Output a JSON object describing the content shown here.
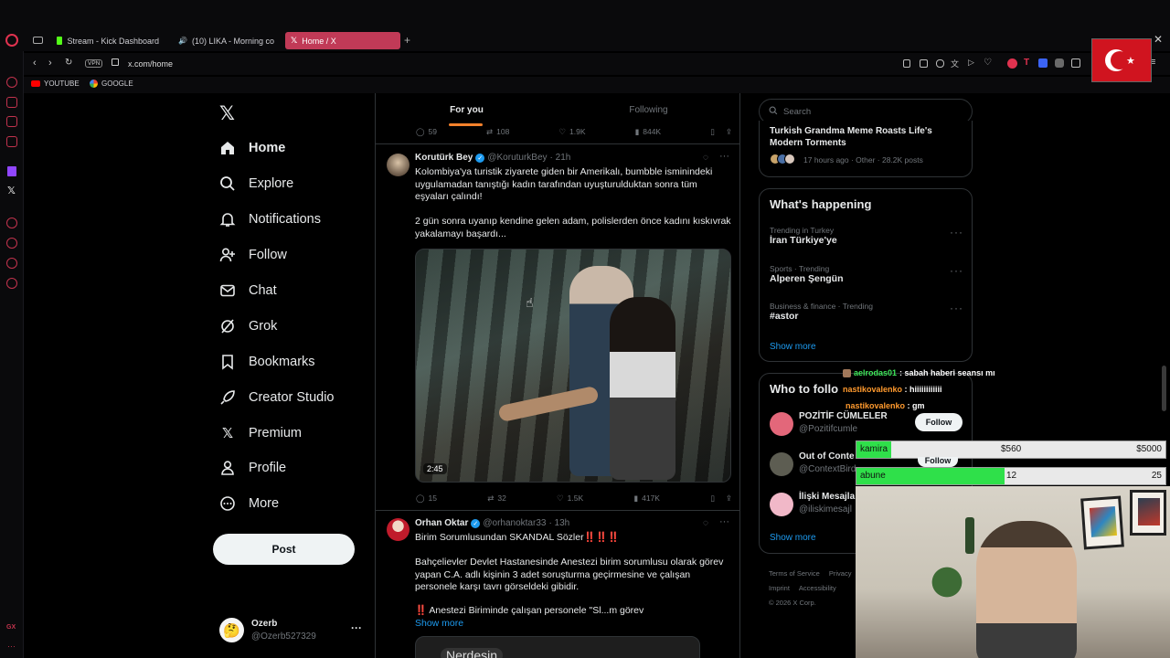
{
  "browser": {
    "tabs": [
      {
        "label": "Stream - Kick Dashboard",
        "icon": "kick-icon"
      },
      {
        "label": "(10) LIKA - Morning co",
        "icon": "youtube-icon"
      },
      {
        "label": "Home / X",
        "icon": "x-icon"
      }
    ],
    "vpn_label": "VPN",
    "url": "x.com/home",
    "bookmarks": [
      {
        "label": "YOUTUBE",
        "icon": "youtube-icon"
      },
      {
        "label": "GOOGLE",
        "icon": "google-icon"
      }
    ]
  },
  "sidebar": {
    "items": [
      {
        "label": "Home",
        "icon": "home-icon"
      },
      {
        "label": "Explore",
        "icon": "search-icon"
      },
      {
        "label": "Notifications",
        "icon": "bell-icon"
      },
      {
        "label": "Follow",
        "icon": "add-person-icon"
      },
      {
        "label": "Chat",
        "icon": "mail-icon"
      },
      {
        "label": "Grok",
        "icon": "grok-icon"
      },
      {
        "label": "Bookmarks",
        "icon": "bookmark-icon"
      },
      {
        "label": "Creator Studio",
        "icon": "rocket-icon"
      },
      {
        "label": "Premium",
        "icon": "x-icon"
      },
      {
        "label": "Profile",
        "icon": "person-icon"
      },
      {
        "label": "More",
        "icon": "more-circle-icon"
      }
    ],
    "post_button": "Post",
    "account": {
      "name": "Ozerb",
      "handle": "@Ozerb527329"
    }
  },
  "timeline": {
    "tabs": [
      "For you",
      "Following"
    ],
    "prev_metrics": {
      "replies": "59",
      "reposts": "108",
      "likes": "1.9K",
      "views": "844K"
    },
    "tweets": [
      {
        "name": "Korutürk Bey",
        "handle": "@KoruturkBey",
        "time": "· 21h",
        "text1": "Kolombiya'ya turistik ziyarete giden bir Amerikalı, bumbble isminindeki uygulamadan tanıştığı kadın tarafından uyuşturulduktan sonra tüm eşyaları çalındı!",
        "text2": "2 gün sonra uyanıp kendine gelen adam, polislerden önce kadını kıskıvrak yakalamayı başardı...",
        "video_duration": "2:45",
        "metrics": {
          "replies": "15",
          "reposts": "32",
          "likes": "1.5K",
          "views": "417K"
        }
      },
      {
        "name": "Orhan Oktar",
        "handle": "@orhanoktar33",
        "time": "· 13h",
        "text1": "Birim Sorumlusundan SKANDAL Sözler‼️‼️‼️",
        "text2": "Bahçelievler Devlet Hastanesinde Anestezi birim sorumlusu olarak görev yapan  C.A. adlı kişinin 3 adet soruşturma geçirmesine ve çalışan personele karşı tavrı görseldeki gibidir.",
        "text3": "‼️ Anestezi Biriminde çalışan personele \"Sl...m görev",
        "show_more": "Show more",
        "media_caption": "Nerdesin"
      }
    ]
  },
  "right": {
    "search_placeholder": "Search",
    "top_story": {
      "title": "Turkish Grandma Meme Roasts Life's Modern Torments",
      "meta": "17 hours ago · Other · 28.2K posts"
    },
    "happening": {
      "title": "What's happening",
      "trends": [
        {
          "meta": "Trending in Turkey",
          "name": "İran Türkiye'ye"
        },
        {
          "meta": "Sports · Trending",
          "name": "Alperen Şengün"
        },
        {
          "meta": "Business & finance · Trending",
          "name": "#astor"
        }
      ],
      "show_more": "Show more"
    },
    "who_to_follow": {
      "title": "Who to follo",
      "accounts": [
        {
          "name": "POZİTİF CÜMLELER",
          "handle": "@Pozitifcumle",
          "button": "Follow"
        },
        {
          "name": "Out of Conte",
          "handle": "@ContextBird",
          "button": "Follow"
        },
        {
          "name": "İlişki Mesajla",
          "handle": "@iliskimesajl",
          "button": ""
        }
      ],
      "show_more": "Show more"
    },
    "footer": {
      "row1": [
        "Terms of Service",
        "Privacy"
      ],
      "row2": [
        "Imprint",
        "Accessibility"
      ],
      "copyright": "© 2026 X Corp."
    }
  },
  "overlay": {
    "chat": [
      {
        "user": "aelrodas01",
        "message": ": sabah haberi seansı mı",
        "color": "#3ee85a"
      },
      {
        "user": "nastikovalenko",
        "message": ": hiiiiiiiiiiii",
        "color": "#ff9a2e"
      },
      {
        "user": "nastikovalenko",
        "message": ": gm",
        "color": "#ff9a2e"
      }
    ],
    "goals": [
      {
        "label": "kamira",
        "current": "$560",
        "target": "$5000",
        "progress": 0.112
      },
      {
        "label": "abune",
        "current": "12",
        "target": "25",
        "progress": 0.48
      }
    ]
  },
  "colors": {
    "accent": "#1d9bf0",
    "opera_red": "#c2334d",
    "tab_active": "#c13a57",
    "goal_green": "#2fe04a"
  }
}
